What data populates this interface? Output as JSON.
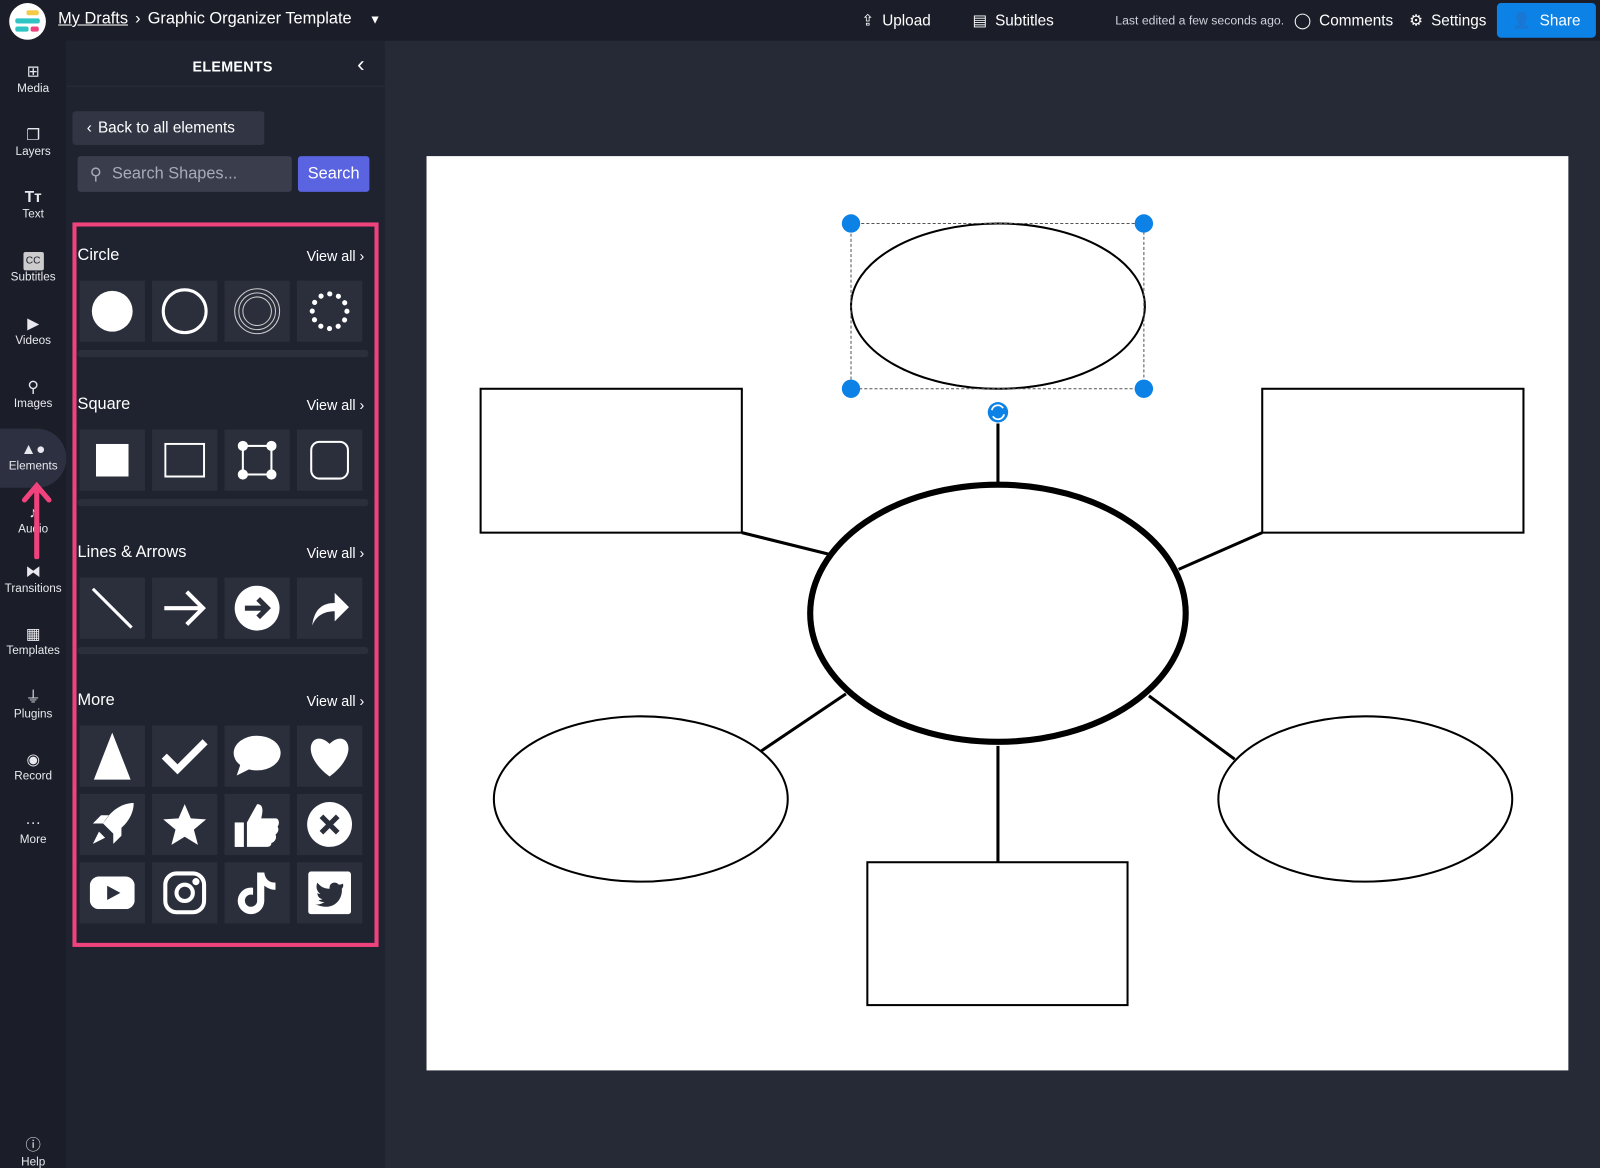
{
  "header": {
    "breadcrumb_root": "My Drafts",
    "project_title": "Graphic Organizer Template",
    "upload": "Upload",
    "subtitles": "Subtitles",
    "last_edited": "Last edited a few seconds ago.",
    "comments": "Comments",
    "settings": "Settings",
    "share": "Share"
  },
  "rail": [
    {
      "label": "Media",
      "icon": "media-icon"
    },
    {
      "label": "Layers",
      "icon": "layers-icon"
    },
    {
      "label": "Text",
      "icon": "text-icon"
    },
    {
      "label": "Subtitles",
      "icon": "cc-icon"
    },
    {
      "label": "Videos",
      "icon": "video-icon"
    },
    {
      "label": "Images",
      "icon": "search-icon"
    },
    {
      "label": "Elements",
      "icon": "shapes-icon"
    },
    {
      "label": "Audio",
      "icon": "audio-icon"
    },
    {
      "label": "Transitions",
      "icon": "transition-icon"
    },
    {
      "label": "Templates",
      "icon": "templates-icon"
    },
    {
      "label": "Plugins",
      "icon": "plugin-icon"
    },
    {
      "label": "Record",
      "icon": "record-icon"
    },
    {
      "label": "More",
      "icon": "more-icon"
    }
  ],
  "help": "Help",
  "panel": {
    "title": "ELEMENTS",
    "back": "Back to all elements",
    "search_placeholder": "Search Shapes...",
    "search_button": "Search",
    "sections": [
      {
        "title": "Circle",
        "view_all": "View all ›",
        "items": [
          "filled-circle",
          "outline-circle",
          "concentric-circle",
          "dotted-circle"
        ]
      },
      {
        "title": "Square",
        "view_all": "View all ›",
        "items": [
          "filled-square",
          "outline-square",
          "transform-square",
          "rounded-square"
        ]
      },
      {
        "title": "Lines & Arrows",
        "view_all": "View all ›",
        "items": [
          "diagonal-line",
          "arrow-right",
          "circle-arrow",
          "curved-arrow"
        ]
      },
      {
        "title": "More",
        "view_all": "View all ›",
        "items": [
          "triangle",
          "checkmark",
          "speech-bubble",
          "heart",
          "rocket",
          "star",
          "thumbs-up",
          "x-circle",
          "youtube",
          "instagram",
          "tiktok",
          "twitter"
        ]
      }
    ]
  },
  "colors": {
    "accent": "#0d82e6",
    "highlight": "#f0427d",
    "search": "#5a63e0"
  }
}
